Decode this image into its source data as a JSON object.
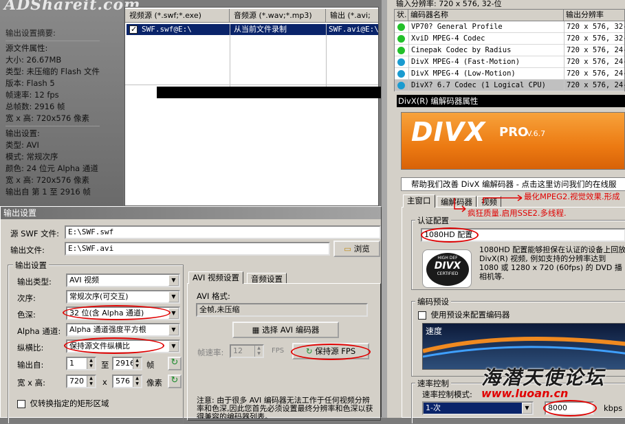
{
  "left_panel": {
    "logo": "ADShareit.com",
    "summary_title": "输出设置摘要:",
    "source_title": "源文件属性:",
    "source_lines": [
      "大小: 26.67MB",
      "类型: 未压缩的 Flash 文件",
      "版本: Flash 5",
      "帧速率: 12 fps",
      "总帧数: 2916 帧",
      "宽 x 高: 720x576 像素"
    ],
    "output_title": "输出设置:",
    "output_lines": [
      "类型: AVI",
      "模式: 常规次序",
      "颜色: 24 位元 Alpha 通道",
      "宽 x 高: 720x576 像素",
      "输出自 第 1 至 2916 帧"
    ]
  },
  "file_list": {
    "headers": [
      "视频源 (*.swf;*.exe)",
      "音频源 (*.wav;*.mp3)",
      "输出 (*.avi;"
    ],
    "row": {
      "video": "SWF.swf@E:\\",
      "audio": "从当前文件录制",
      "output": "SWF.avi@E:\\"
    }
  },
  "dialog": {
    "title": "输出设置",
    "source_label": "源 SWF 文件:",
    "source_value": "E:\\SWF.swf",
    "output_label": "输出文件:",
    "output_value": "E:\\SWF.avi",
    "browse_button": "浏览",
    "group_title": "输出设置",
    "type_label": "输出类型:",
    "type_value": "AVI 视频",
    "order_label": "次序:",
    "order_value": "常规次序(可交互)",
    "color_label": "色深:",
    "color_value": "32 位(含 Alpha 通道)",
    "alpha_label": "Alpha 通道:",
    "alpha_value": "Alpha 通道强度平方根",
    "aspect_label": "纵横比:",
    "aspect_value": "保持源文件纵横比",
    "from_label": "输出自:",
    "from_value": "1",
    "to_label": "至",
    "to_value": "2916",
    "frame_unit": "帧",
    "size_label": "宽 x 高:",
    "width_value": "720",
    "x_label": "x",
    "height_value": "576",
    "pixel_unit": "像素",
    "rect_checkbox": "仅转换指定的矩形区域",
    "tab_avi": "AVI 视频设置",
    "tab_audio": "音频设置",
    "avi_format_label": "AVI 格式:",
    "avi_format_value": "全帧,未压缩",
    "select_encoder_button": "选择 AVI 编码器",
    "fps_label": "帧速率:",
    "fps_value": "12",
    "fps_unit": "FPS",
    "keep_fps_button": "保持源 FPS",
    "note": "注意: 由于很多 AVI 编码器无法工作于任何视频分辨率和色深,因此您首先必须设置最终分辨率和色深以获得兼容的编码器列表。"
  },
  "right_panel": {
    "resolution_line": "输入分辨率:  720 x 576, 32-位",
    "codec_headers": [
      "状.",
      "编码器名称",
      "输出分辨率"
    ],
    "codecs": [
      {
        "name": "VP70? General Profile",
        "res": "720 x 576, 32-",
        "color": "#22c02a"
      },
      {
        "name": "XviD MPEG-4 Codec",
        "res": "720 x 576, 32-",
        "color": "#22c02a"
      },
      {
        "name": "Cinepak Codec by Radius",
        "res": "720 x 576, 24-",
        "color": "#22c02a"
      },
      {
        "name": "DivX MPEG-4 (Fast-Motion)",
        "res": "720 x 576, 24-",
        "color": "#1a9bd0"
      },
      {
        "name": "DivX MPEG-4 (Low-Motion)",
        "res": "720 x 576, 24-",
        "color": "#1a9bd0"
      },
      {
        "name": "DivX? 6.7 Codec (1 Logical CPU)",
        "res": "720 x 576, 24-",
        "color": "#1a9bd0"
      }
    ],
    "divx_title": "DivX(R) 编解码器属性",
    "divx_logo": "DIVX",
    "divx_pro": "PRO",
    "divx_version": "V.6.7",
    "help_text": "帮助我们改善 DivX 编解码器 - 点击这里访问我们的在线服",
    "tabs": [
      "主窗口",
      "编解码器",
      "视频"
    ],
    "annotation_1": "疯狂质量.启用SSE2.多线程.",
    "annotation_2": "最化MPEG2.视觉效果.形成",
    "auth_title": "认证配置",
    "auth_value": "1080HD 配置",
    "auth_desc": "1080HD 配置能够担保在认证的设备上回放DivX(R) 视频, 例如支持的分辨率达到 1080 或 1280 x 720 (60fps) 的 DVD 播相机等.",
    "cert_top": "HIGH DEF",
    "cert_logo": "DIVX",
    "cert_bottom": "CERTIFIED",
    "preset_title": "编码预设",
    "preset_checkbox": "使用预设来配置编码器",
    "preview_label": "速度",
    "rate_title": "速率控制",
    "rate_mode_label": "速率控制模式:",
    "rate_mode_value": "1-次",
    "bitrate_value": "8000",
    "bitrate_unit": "kbps",
    "watermark": "海潜天使论坛",
    "watermark_url": "www.luoan.cn"
  }
}
